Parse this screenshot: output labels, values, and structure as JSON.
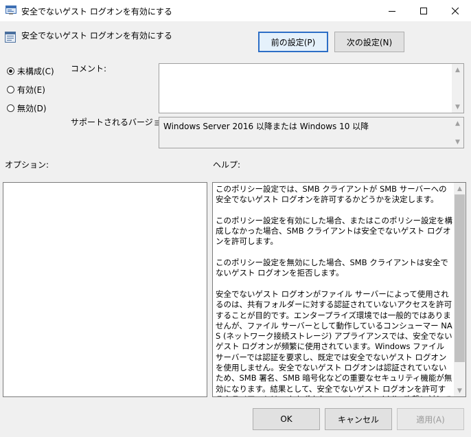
{
  "window": {
    "title": "安全でないゲスト ログオンを有効にする",
    "controls": {
      "minimize": "minimize-icon",
      "maximize": "maximize-icon",
      "close": "close-icon"
    }
  },
  "policy": {
    "name": "安全でないゲスト ログオンを有効にする",
    "prev_button": "前の設定(P)",
    "next_button": "次の設定(N)"
  },
  "state": {
    "options": [
      {
        "label": "未構成(C)",
        "checked": true
      },
      {
        "label": "有効(E)",
        "checked": false
      },
      {
        "label": "無効(D)",
        "checked": false
      }
    ]
  },
  "comment": {
    "label": "コメント:",
    "value": ""
  },
  "supported": {
    "label": "サポートされるバージョン:",
    "value": "Windows Server 2016 以降または Windows 10 以降"
  },
  "options_pane": {
    "label": "オプション:"
  },
  "help": {
    "label": "ヘルプ:",
    "text": "このポリシー設定では、SMB クライアントが SMB サーバーへの安全でないゲスト ログオンを許可するかどうかを決定します。\n\nこのポリシー設定を有効にした場合、またはこのポリシー設定を構成しなかった場合、SMB クライアントは安全でないゲスト ログオンを許可します。\n\nこのポリシー設定を無効にした場合、SMB クライアントは安全でないゲスト ログオンを拒否します。\n\n安全でないゲスト ログオンがファイル サーバーによって使用されるのは、共有フォルダーに対する認証されていないアクセスを許可することが目的です。エンタープライズ環境では一般的ではありませんが、ファイル サーバーとして動作しているコンシューマー NAS (ネットワーク接続ストレージ) アプライアンスでは、安全でないゲスト ログオンが頻繁に使用されています。Windows ファイル サーバーでは認証を要求し、既定では安全でないゲスト ログオンを使用しません。安全でないゲスト ログオンは認証されていないため、SMB 署名、SMB 暗号化などの重要なセキュリティ機能が無効になります。結果として、安全でないゲスト ログオンを許可するクライアントは、さまざまな man-in-the-middle 攻撃に対して脆弱になり、データ損失、データの破損、マルウェアに対するリスクにつながる可能性があります。また、安全でないゲスト ログオンを使用してファイル サーバーに書き込まれ",
    "scroll_position": 0.0,
    "scroll_visible_fraction": 0.88
  },
  "footer": {
    "ok": "OK",
    "cancel": "キャンセル",
    "apply": "適用(A)"
  }
}
